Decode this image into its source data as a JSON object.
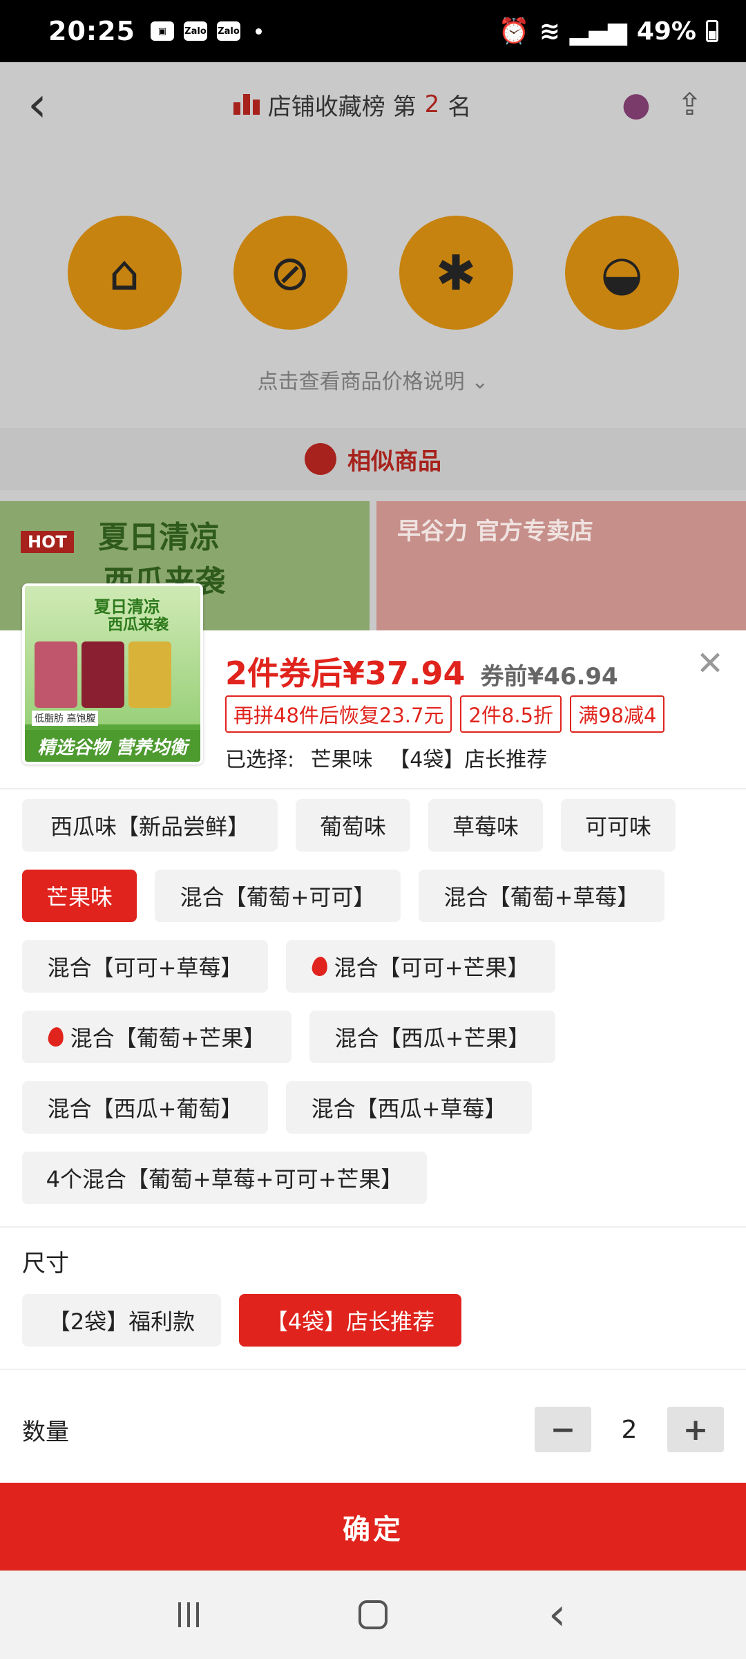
{
  "status_bar": {
    "time": "20:25",
    "left_icons": [
      "gallery-icon",
      "Zalo",
      "Zalo"
    ],
    "battery": "49%"
  },
  "background_page": {
    "rank_text_prefix": "店铺收藏榜 第",
    "rank_number": "2",
    "rank_text_suffix": "名",
    "price_info_link": "点击查看商品价格说明",
    "similar_title": "相似商品",
    "banner_left_text": "夏日清凉",
    "banner_left_text2": "西瓜来袭",
    "banner_right_text": "早谷力 官方专卖店"
  },
  "product": {
    "thumb_title1": "夏日清凉",
    "thumb_title2": "西瓜来袭",
    "thumb_tags": "低脂肪 高饱腹",
    "thumb_caption": "精选谷物 营养均衡",
    "price_after_coupon": "2件券后¥37.94",
    "price_before_coupon": "券前¥46.94",
    "promos": [
      "再拼48件后恢复23.7元",
      "2件8.5折",
      "满98减4"
    ],
    "selected_label": "已选择:",
    "selected_flavor": "芒果味",
    "selected_size": "【4袋】店长推荐"
  },
  "flavors": [
    {
      "label": "西瓜味【新品尝鲜】",
      "hot": false,
      "selected": false
    },
    {
      "label": "葡萄味",
      "hot": false,
      "selected": false
    },
    {
      "label": "草莓味",
      "hot": false,
      "selected": false
    },
    {
      "label": "可可味",
      "hot": false,
      "selected": false
    },
    {
      "label": "芒果味",
      "hot": false,
      "selected": true
    },
    {
      "label": "混合【葡萄+可可】",
      "hot": false,
      "selected": false
    },
    {
      "label": "混合【葡萄+草莓】",
      "hot": false,
      "selected": false
    },
    {
      "label": "混合【可可+草莓】",
      "hot": false,
      "selected": false
    },
    {
      "label": "混合【可可+芒果】",
      "hot": true,
      "selected": false
    },
    {
      "label": "混合【葡萄+芒果】",
      "hot": true,
      "selected": false
    },
    {
      "label": "混合【西瓜+芒果】",
      "hot": false,
      "selected": false
    },
    {
      "label": "混合【西瓜+葡萄】",
      "hot": false,
      "selected": false
    },
    {
      "label": "混合【西瓜+草莓】",
      "hot": false,
      "selected": false
    },
    {
      "label": "4个混合【葡萄+草莓+可可+芒果】",
      "hot": false,
      "selected": false
    }
  ],
  "size": {
    "title": "尺寸",
    "options": [
      {
        "label": "【2袋】福利款",
        "selected": false
      },
      {
        "label": "【4袋】店长推荐",
        "selected": true
      }
    ]
  },
  "quantity": {
    "label": "数量",
    "value": "2",
    "minus": "−",
    "plus": "+"
  },
  "confirm_label": "确定",
  "colors": {
    "accent": "#e0231c",
    "chip_bg": "#f2f2f2"
  }
}
